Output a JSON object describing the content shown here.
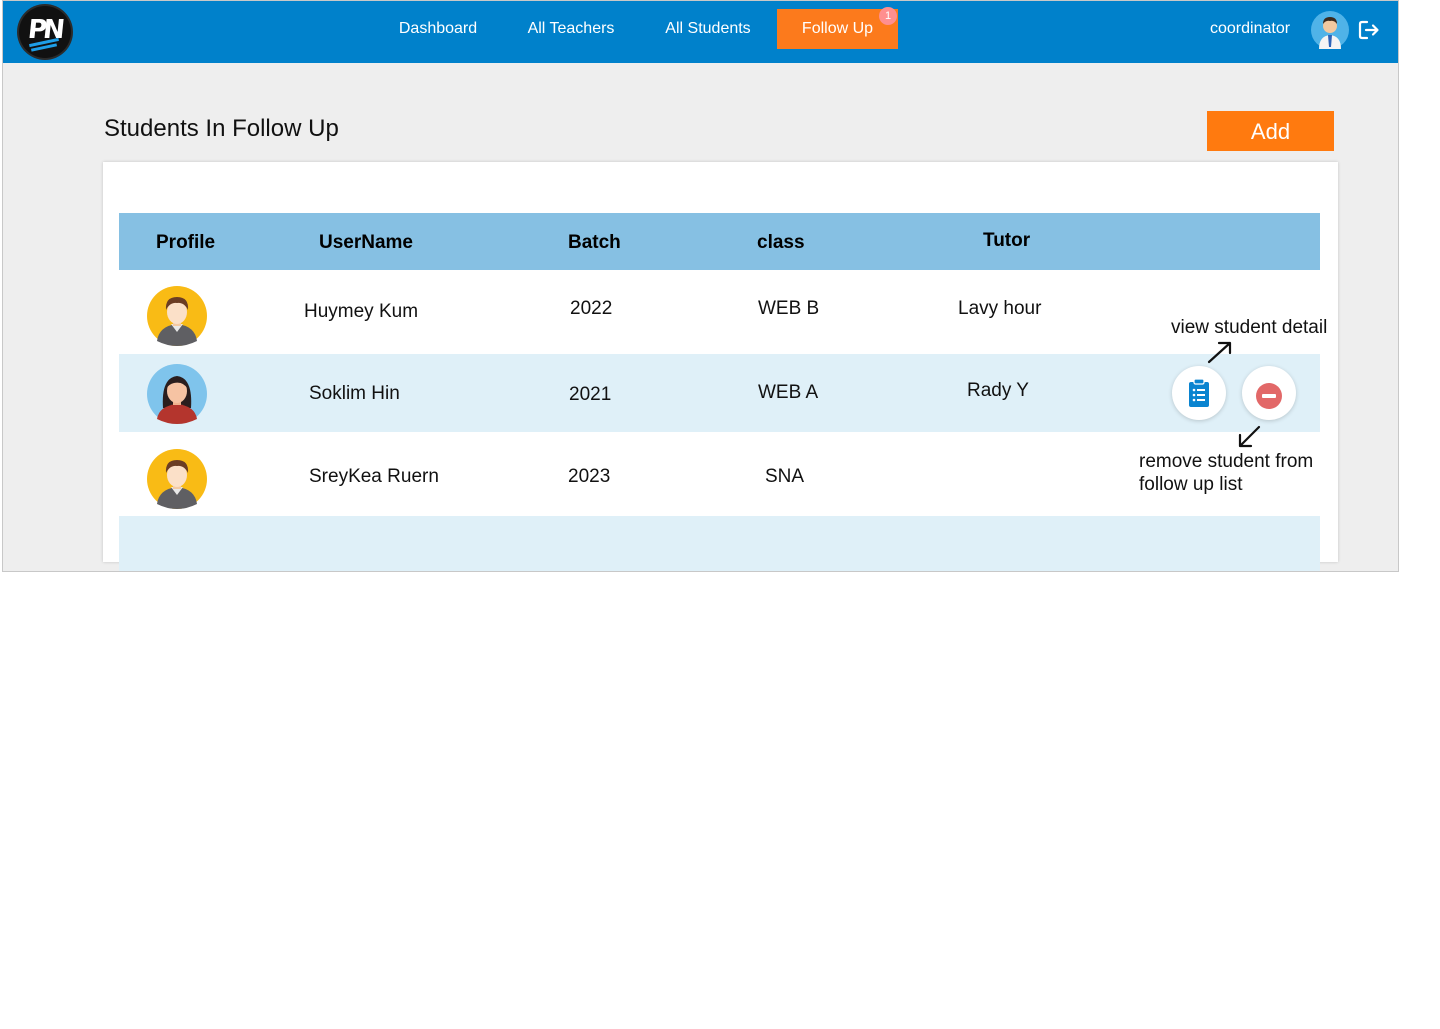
{
  "navbar": {
    "logo_text": "PN",
    "items": [
      {
        "label": "Dashboard"
      },
      {
        "label": "All Teachers"
      },
      {
        "label": "All Students"
      },
      {
        "label": "Follow Up",
        "badge": "1",
        "active": true
      }
    ],
    "user_label": "coordinator",
    "icons": [
      "user-avatar-icon",
      "logout-icon"
    ]
  },
  "page": {
    "title": "Students In Follow Up",
    "add_label": "Add"
  },
  "table": {
    "headers": [
      "Profile",
      "UserName",
      "Batch",
      "class",
      "Tutor"
    ],
    "rows": [
      {
        "avatar": "male-avatar",
        "username": "Huymey Kum",
        "batch": "2022",
        "class": "WEB B",
        "tutor": "Lavy hour"
      },
      {
        "avatar": "female-avatar",
        "username": "Soklim Hin",
        "batch": "2021",
        "class": "WEB A",
        "tutor": "Rady Y"
      },
      {
        "avatar": "male-avatar",
        "username": "SreyKea Ruern",
        "batch": "2023",
        "class": "SNA",
        "tutor": ""
      }
    ]
  },
  "annotations": {
    "view": "view student detail",
    "remove_line1": "remove student from",
    "remove_line2": "follow up list"
  },
  "colors": {
    "navbar": "#0081cb",
    "accent": "#fc7a1c",
    "table_header": "#86c0e3",
    "row_alt": "#dff0f8",
    "view_icon": "#0a84d0",
    "remove_icon": "#e26868"
  }
}
